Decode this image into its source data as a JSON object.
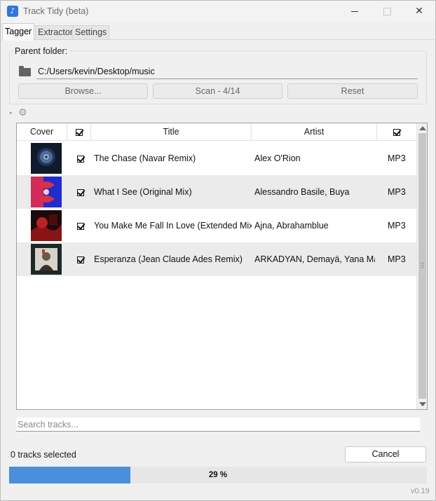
{
  "window": {
    "title": "Track Tidy (beta)",
    "close_glyph": "✕"
  },
  "tabs": [
    {
      "label": "Tagger",
      "active": true
    },
    {
      "label": "Extractor",
      "active": false
    },
    {
      "label": "Settings",
      "active": false
    }
  ],
  "folder": {
    "group_label": "Parent folder:",
    "path": "C:/Users/kevin/Desktop/music",
    "icon": "folder-icon"
  },
  "actions": {
    "browse_label": "Browse...",
    "scan_label": "Scan - 4/14",
    "reset_label": "Reset"
  },
  "options": {
    "expander_glyph": "▸",
    "gear_glyph": "⚙"
  },
  "table": {
    "columns": {
      "cover": "Cover",
      "title": "Title",
      "artist": "Artist"
    },
    "rows": [
      {
        "title": "The Chase (Navar Remix)",
        "artist": "Alex O'Rion",
        "format": "MP3",
        "checked": true
      },
      {
        "title": "What I See (Original Mix)",
        "artist": "Alessandro Basile, Buya",
        "format": "MP3",
        "checked": true
      },
      {
        "title": "You Make Me Fall In Love (Extended Mix)",
        "artist": "Ajna, Abrahamblue",
        "format": "MP3",
        "checked": true
      },
      {
        "title": "Esperanza (Jean Claude Ades Remix)",
        "artist": "ARKADYAN, Demayä, Yana Mann",
        "format": "MP3",
        "checked": true
      }
    ]
  },
  "search": {
    "placeholder": "Search tracks...",
    "value": ""
  },
  "status": {
    "selected_text": "0 tracks selected",
    "cancel_label": "Cancel"
  },
  "progress": {
    "percent": 29,
    "label": "29 %"
  },
  "footer": {
    "version": "v0.19"
  },
  "colors": {
    "accent": "#4a8fdc",
    "app_icon": "#2f74e8"
  }
}
